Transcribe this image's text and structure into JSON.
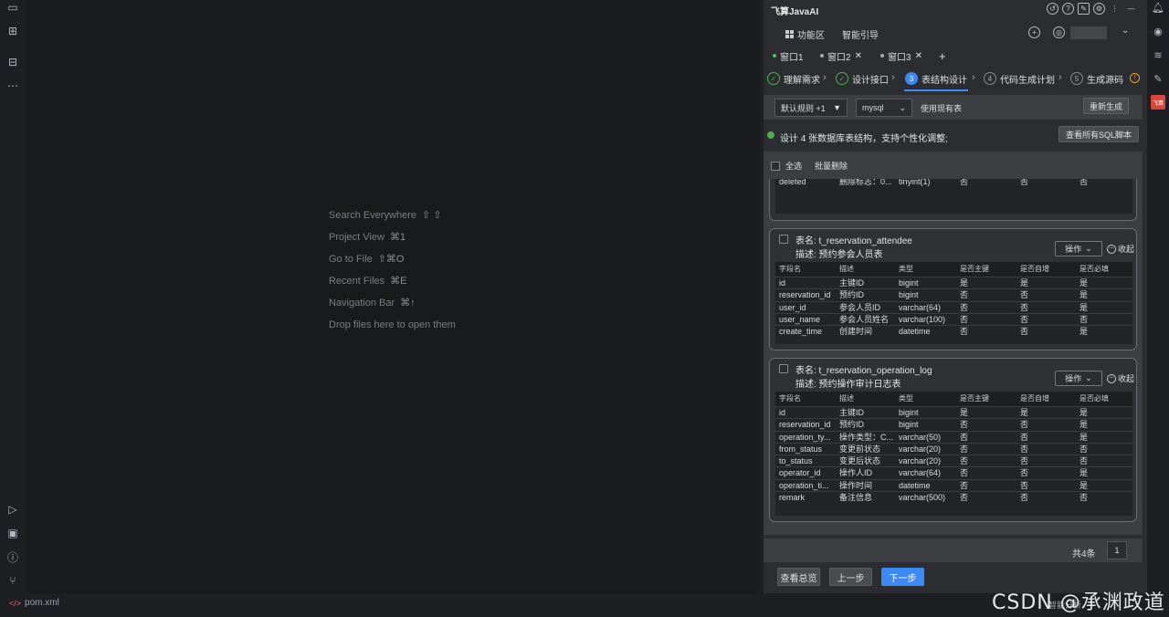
{
  "welcome": [
    {
      "label": "Search Everywhere",
      "key": "⇧ ⇧"
    },
    {
      "label": "Project View",
      "key": "⌘1"
    },
    {
      "label": "Go to File",
      "key": "⇧⌘O"
    },
    {
      "label": "Recent Files",
      "key": "⌘E"
    },
    {
      "label": "Navigation Bar",
      "key": "⌘↑"
    },
    {
      "label": "Drop files here to open them",
      "key": ""
    }
  ],
  "status": {
    "file": "pom.xml",
    "right": "智能分析"
  },
  "watermark": "CSDN @承渊政道",
  "panel": {
    "title": "飞算JavaAI",
    "main_tabs": [
      "功能区",
      "智能引导"
    ],
    "windows": [
      "窗口1",
      "窗口2",
      "窗口3"
    ],
    "steps": [
      {
        "num": "✓",
        "label": "理解需求",
        "state": "done"
      },
      {
        "num": "✓",
        "label": "设计接口",
        "state": "done"
      },
      {
        "num": "3",
        "label": "表结构设计",
        "state": "active"
      },
      {
        "num": "4",
        "label": "代码生成计划",
        "state": "todo"
      },
      {
        "num": "5",
        "label": "生成源码",
        "state": "todo"
      }
    ],
    "rule_select": "默认规则 +1",
    "db_select": "mysql",
    "use_existing": "使用现有表",
    "regenerate": "重新生成",
    "info": "设计 4 张数据库表结构，支持个性化调整;",
    "view_sql": "查看所有SQL脚本",
    "select_all": "全选",
    "batch_delete": "批量删除",
    "partial_row": [
      "deleted",
      "删除标志：0...",
      "tinyint(1)",
      "否",
      "否",
      "否"
    ],
    "headers": [
      "字段名",
      "描述",
      "类型",
      "是否主键",
      "是否自增",
      "是否必填"
    ],
    "op_label": "操作",
    "collapse_label": "收起",
    "table_label_prefix": "表名: ",
    "desc_label_prefix": "描述: ",
    "tables": [
      {
        "name": "表名: t_reservation_attendee",
        "desc": "描述: 预约参会人员表",
        "rows": [
          [
            "id",
            "主键ID",
            "bigint",
            "是",
            "是",
            "是"
          ],
          [
            "reservation_id",
            "预约ID",
            "bigint",
            "否",
            "否",
            "是"
          ],
          [
            "user_id",
            "参会人员ID",
            "varchar(64)",
            "否",
            "否",
            "是"
          ],
          [
            "user_name",
            "参会人员姓名",
            "varchar(100)",
            "否",
            "否",
            "否"
          ],
          [
            "create_time",
            "创建时间",
            "datetime",
            "否",
            "否",
            "是"
          ]
        ]
      },
      {
        "name": "表名: t_reservation_operation_log",
        "desc": "描述: 预约操作审计日志表",
        "rows": [
          [
            "id",
            "主键ID",
            "bigint",
            "是",
            "是",
            "是"
          ],
          [
            "reservation_id",
            "预约ID",
            "bigint",
            "否",
            "否",
            "是"
          ],
          [
            "operation_ty...",
            "操作类型：C...",
            "varchar(50)",
            "否",
            "否",
            "是"
          ],
          [
            "from_status",
            "变更前状态",
            "varchar(20)",
            "否",
            "否",
            "否"
          ],
          [
            "to_status",
            "变更后状态",
            "varchar(20)",
            "否",
            "否",
            "否"
          ],
          [
            "operator_id",
            "操作人ID",
            "varchar(64)",
            "否",
            "否",
            "是"
          ],
          [
            "operation_ti...",
            "操作时间",
            "datetime",
            "否",
            "否",
            "是"
          ],
          [
            "remark",
            "备注信息",
            "varchar(500)",
            "否",
            "否",
            "否"
          ]
        ]
      }
    ],
    "total": "共4条",
    "page": "1",
    "overview": "查看总览",
    "prev": "上一步",
    "next": "下一步"
  },
  "colors": {
    "accent": "#3d8af7",
    "done": "#4caf50",
    "bg": "#2b2d30"
  }
}
